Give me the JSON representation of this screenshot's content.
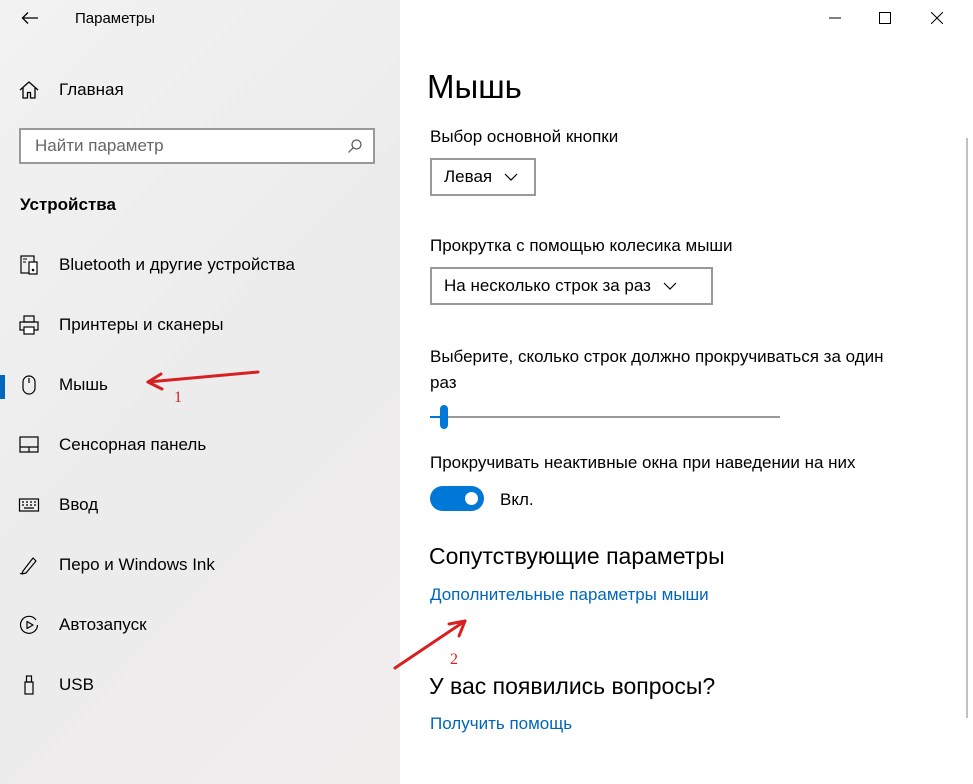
{
  "window": {
    "app_title": "Параметры",
    "controls": {
      "minimize": "minimize-icon",
      "maximize": "maximize-icon",
      "close": "close-icon"
    }
  },
  "sidebar": {
    "home_label": "Главная",
    "search_placeholder": "Найти параметр",
    "section_title": "Устройства",
    "items": [
      {
        "label": "Bluetooth и другие устройства",
        "icon": "bluetooth-devices-icon"
      },
      {
        "label": "Принтеры и сканеры",
        "icon": "printer-icon"
      },
      {
        "label": "Мышь",
        "icon": "mouse-icon",
        "selected": true
      },
      {
        "label": "Сенсорная панель",
        "icon": "touchpad-icon"
      },
      {
        "label": "Ввод",
        "icon": "keyboard-icon"
      },
      {
        "label": "Перо и Windows Ink",
        "icon": "pen-icon"
      },
      {
        "label": "Автозапуск",
        "icon": "autoplay-icon"
      },
      {
        "label": "USB",
        "icon": "usb-icon"
      }
    ]
  },
  "main": {
    "title": "Мышь",
    "primary_button": {
      "label": "Выбор основной кнопки",
      "value": "Левая"
    },
    "scroll_mode": {
      "label": "Прокрутка с помощью колесика мыши",
      "value": "На несколько строк за раз"
    },
    "lines_to_scroll": {
      "label_line1": "Выберите, сколько строк должно прокручиваться за один",
      "label_line2": "раз",
      "slider_fraction": 0.03
    },
    "inactive_scroll": {
      "label": "Прокручивать неактивные окна при наведении на них",
      "state": "Вкл.",
      "on": true
    },
    "related": {
      "heading": "Сопутствующие параметры",
      "link": "Дополнительные параметры мыши"
    },
    "questions": {
      "heading": "У вас появились вопросы?",
      "link": "Получить помощь"
    }
  },
  "annotations": {
    "marker1": "1",
    "marker2": "2",
    "color": "#d92020"
  },
  "colors": {
    "accent": "#0078d7",
    "link": "#0067b8"
  }
}
